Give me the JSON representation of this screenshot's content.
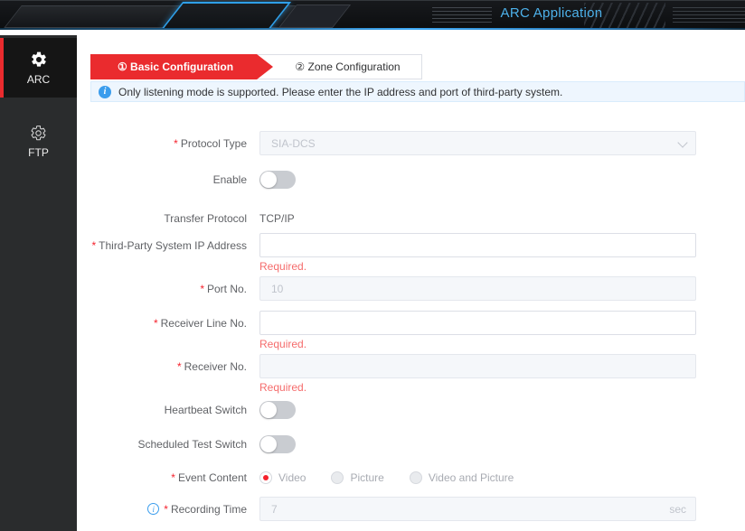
{
  "header": {
    "title": "ARC Application"
  },
  "colors": {
    "accent_red": "#ea2b2e",
    "title_blue": "#4db1ea",
    "info_blue": "#3b9ded",
    "error_red": "#f56c6c",
    "disabled_bg": "#f5f7fa"
  },
  "icons": {
    "banner_info": "i",
    "tip_info": "i"
  },
  "required_marker": "*",
  "sidebar": {
    "items": [
      {
        "label": "ARC",
        "icon": "gear-icon",
        "active": true
      },
      {
        "label": "FTP",
        "icon": "gear-icon",
        "active": false
      }
    ]
  },
  "tabs": [
    {
      "label": "① Basic Configuration",
      "active": true
    },
    {
      "label": "② Zone Configuration",
      "active": false
    }
  ],
  "banner": {
    "text": "Only listening mode is supported. Please enter the IP address and port of third-party system."
  },
  "form": {
    "protocol_type": {
      "label": "Protocol Type",
      "value": "SIA-DCS",
      "disabled": true
    },
    "enable": {
      "label": "Enable",
      "state": "off"
    },
    "transfer_protocol": {
      "label": "Transfer Protocol",
      "value": "TCP/IP"
    },
    "ip_address": {
      "label": "Third-Party System IP Address",
      "value": "",
      "error": "Required."
    },
    "port_no": {
      "label": "Port No.",
      "value": "10",
      "disabled": true
    },
    "receiver_line_no": {
      "label": "Receiver Line No.",
      "value": "",
      "error": "Required."
    },
    "receiver_no": {
      "label": "Receiver No.",
      "value": "",
      "error": "Required."
    },
    "heartbeat_switch": {
      "label": "Heartbeat Switch",
      "state": "off"
    },
    "scheduled_test_switch": {
      "label": "Scheduled Test Switch",
      "state": "off"
    },
    "event_content": {
      "label": "Event Content",
      "options": [
        {
          "label": "Video",
          "selected": true
        },
        {
          "label": "Picture",
          "selected": false
        },
        {
          "label": "Video and Picture",
          "selected": false
        }
      ]
    },
    "recording_time": {
      "label": "Recording Time",
      "value": "7",
      "unit": "sec",
      "disabled": true
    }
  }
}
